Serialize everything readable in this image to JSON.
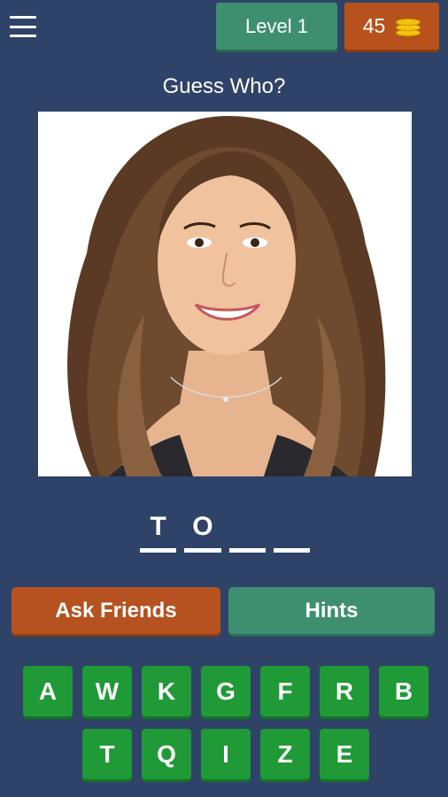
{
  "header": {
    "level_label": "Level 1",
    "coins": "45"
  },
  "title": "Guess Who?",
  "answer": {
    "slots": [
      "T",
      "O",
      "",
      ""
    ]
  },
  "actions": {
    "ask_friends": "Ask Friends",
    "hints": "Hints"
  },
  "keyboard": {
    "row1": [
      "A",
      "W",
      "K",
      "G",
      "F",
      "R",
      "B"
    ],
    "row2": [
      "T",
      "Q",
      "I",
      "Z",
      "E"
    ]
  },
  "colors": {
    "background": "#2f4368",
    "level_green": "#3e8f70",
    "coin_orange": "#b7521d",
    "key_green": "#1f9a36",
    "coin_gold": "#f4c20d"
  },
  "icons": {
    "menu": "hamburger-menu-icon",
    "coins": "coin-stack-icon"
  }
}
